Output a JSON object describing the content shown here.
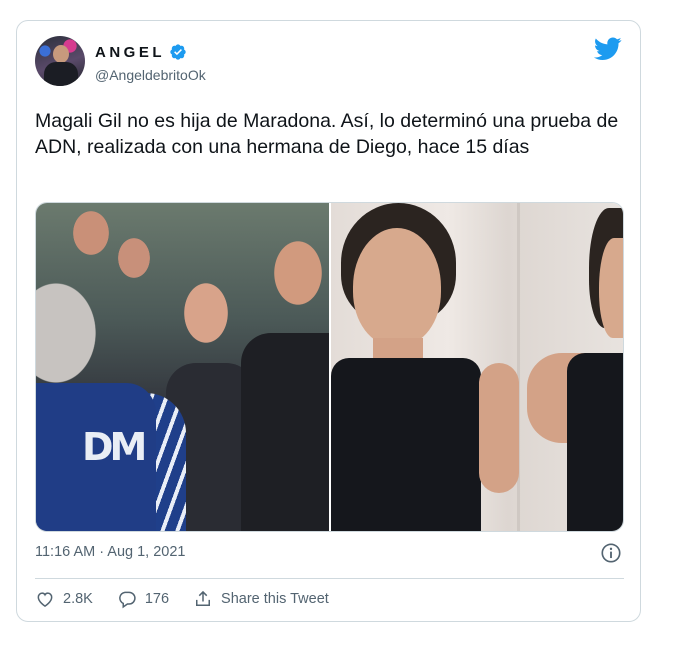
{
  "tweet": {
    "author_name": "ANGEL",
    "author_handle": "@AngeldebritoOk",
    "text": "Magali Gil no es hija de Maradona. Así, lo determinó una prueba de ADN, realizada con una hermana de Diego, hace 15 días",
    "timestamp": "11:16 AM · Aug 1, 2021",
    "likes": "2.8K",
    "replies": "176",
    "share_label": "Share this Tweet",
    "media_left_text": "DM"
  },
  "icons": {
    "brand": "twitter-bird-icon",
    "verified": "verified-badge-icon",
    "info": "info-icon",
    "like": "heart-icon",
    "reply": "reply-bubble-icon",
    "share": "share-icon"
  },
  "colors": {
    "accent": "#1d9bf0",
    "text": "#0f1419",
    "secondary": "#536471",
    "border": "#cfd9de"
  }
}
